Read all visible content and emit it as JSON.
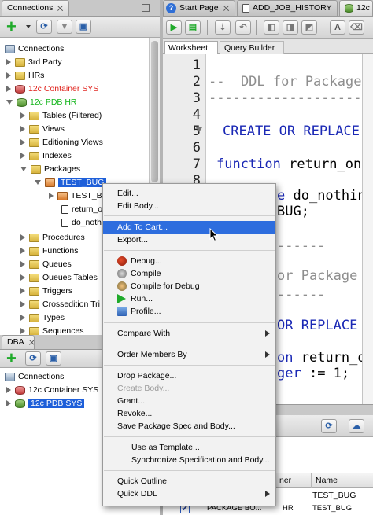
{
  "connections_panel": {
    "title": "Connections",
    "tree": [
      {
        "label": "Connections",
        "color": "#000000"
      },
      {
        "label": "3rd Party",
        "color": "#000000"
      },
      {
        "label": "HRs",
        "color": "#000000"
      },
      {
        "label": "12c Container SYS",
        "color": "#e0201a"
      },
      {
        "label": "12c PDB HR",
        "color": "#12b51a"
      },
      {
        "label": "Tables (Filtered)",
        "color": "#000000"
      },
      {
        "label": "Views",
        "color": "#000000"
      },
      {
        "label": "Editioning Views",
        "color": "#000000"
      },
      {
        "label": "Indexes",
        "color": "#000000"
      },
      {
        "label": "Packages",
        "color": "#000000"
      },
      {
        "label": "TEST_BUG",
        "color": "#ffffff"
      },
      {
        "label": "TEST_BU",
        "color": "#000000"
      },
      {
        "label": "return_o",
        "color": "#000000"
      },
      {
        "label": "do_noth",
        "color": "#000000"
      },
      {
        "label": "Procedures",
        "color": "#000000"
      },
      {
        "label": "Functions",
        "color": "#000000"
      },
      {
        "label": "Queues",
        "color": "#000000"
      },
      {
        "label": "Queues Tables",
        "color": "#000000"
      },
      {
        "label": "Triggers",
        "color": "#000000"
      },
      {
        "label": "Crossedition Tri",
        "color": "#000000"
      },
      {
        "label": "Types",
        "color": "#000000"
      },
      {
        "label": "Sequences",
        "color": "#000000"
      }
    ]
  },
  "dba_panel": {
    "title": "DBA",
    "tree": [
      {
        "label": "Connections"
      },
      {
        "label": "12c Container SYS"
      },
      {
        "label": "12c PDB SYS"
      }
    ]
  },
  "editor_tabs": [
    {
      "label": "Start Page"
    },
    {
      "label": "ADD_JOB_HISTORY"
    },
    {
      "label": "12c"
    }
  ],
  "sub_tabs": {
    "worksheet": "Worksheet",
    "query_builder": "Query Builder"
  },
  "line_numbers": [
    "1",
    "2",
    "3",
    "4",
    "5",
    "6",
    "7",
    "8"
  ],
  "code": {
    "line2": "--  DDL for Package T",
    "line3": "----------------------",
    "line5": "CREATE OR REPLACE E",
    "line7_kw": "function",
    "line7_rest": " return_one",
    "line8_kw": "e",
    "line8_rest": " do_nothing",
    "line9": "BUG;",
    "line10": "------",
    "line11": "or Package Bo",
    "line12": "------",
    "line13": "OR REPLACE E",
    "line14_kw": "on",
    "line14_rest": " return_one",
    "line15_kw": "ger",
    "line15_rest": " := 1;"
  },
  "context_menu": {
    "items": [
      {
        "label": "Edit...",
        "enabled": true
      },
      {
        "label": "Edit Body...",
        "enabled": true
      },
      {
        "label": "Add To Cart...",
        "enabled": true,
        "highlighted": true
      },
      {
        "label": "Export...",
        "enabled": true
      },
      {
        "label": "Debug...",
        "enabled": true,
        "icon": "bug-icon"
      },
      {
        "label": "Compile",
        "enabled": true,
        "icon": "compile-icon"
      },
      {
        "label": "Compile for Debug",
        "enabled": true,
        "icon": "compile-debug-icon"
      },
      {
        "label": "Run...",
        "enabled": true,
        "icon": "run-icon"
      },
      {
        "label": "Profile...",
        "enabled": true,
        "icon": "profile-icon"
      },
      {
        "label": "Compare With",
        "enabled": true,
        "submenu": true
      },
      {
        "label": "Order Members By",
        "enabled": true,
        "submenu": true
      },
      {
        "label": "Drop Package...",
        "enabled": true
      },
      {
        "label": "Create Body...",
        "enabled": false
      },
      {
        "label": "Grant...",
        "enabled": true
      },
      {
        "label": "Revoke...",
        "enabled": true
      },
      {
        "label": "Save Package Spec and Body...",
        "enabled": true
      },
      {
        "label": "Use as Template...",
        "enabled": true
      },
      {
        "label": "Synchronize Specification and Body...",
        "enabled": true
      },
      {
        "label": "Quick Outline",
        "enabled": true
      },
      {
        "label": "Quick DDL",
        "enabled": true,
        "submenu": true
      }
    ]
  },
  "bottom_table": {
    "headers": [
      "ner",
      "Name"
    ],
    "rows": [
      {
        "owner": "",
        "name": "TEST_BUG"
      },
      {
        "type": "PACKAGE BO...",
        "owner": "HR",
        "name": "TEST_BUG"
      }
    ]
  },
  "colors": {
    "selection": "#1e5fd9",
    "menu_highlight": "#2d6dde",
    "keyword": "#1a28b5",
    "comment": "#8e8e8e"
  }
}
